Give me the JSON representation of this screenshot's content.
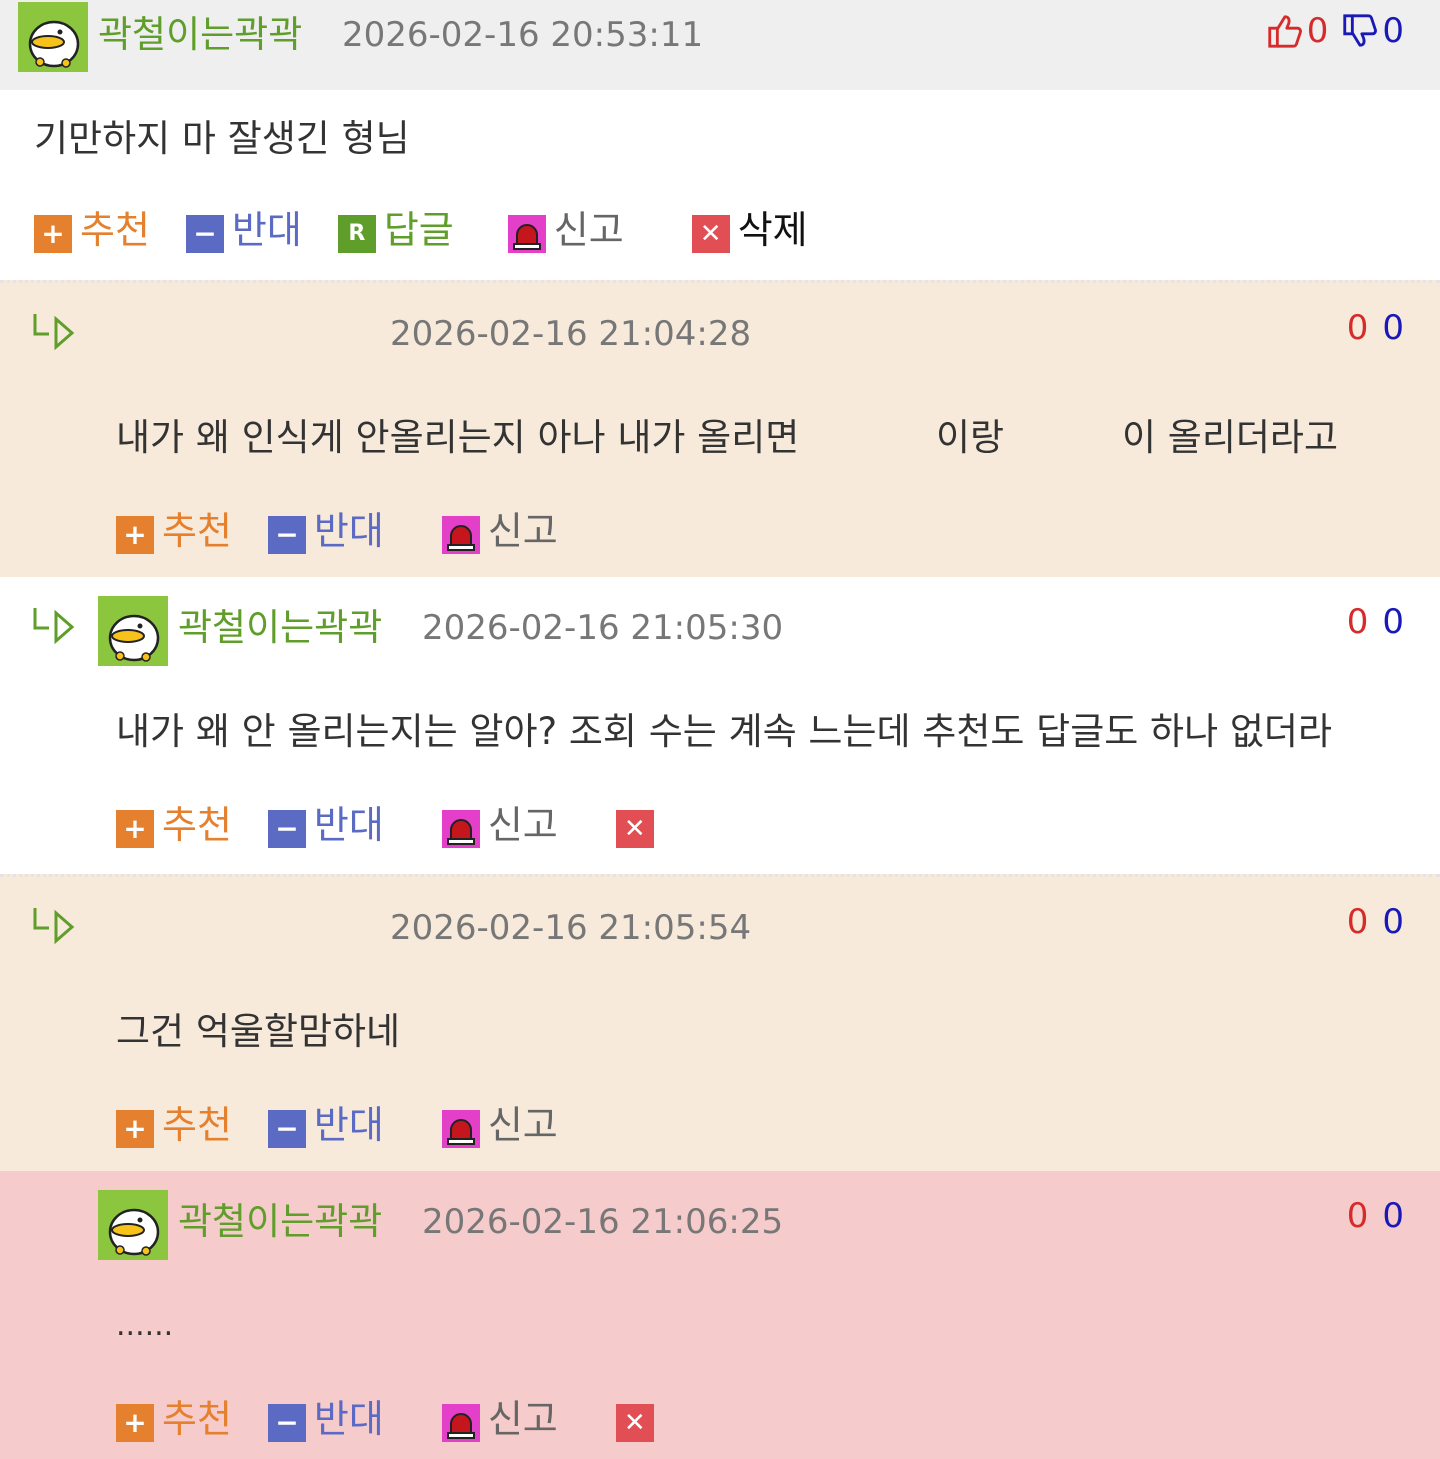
{
  "colors": {
    "header_bg": "#efefef",
    "reply_bg": "#f7eadb",
    "highlight_bg": "#f6cbcb",
    "nick_green": "#5f9e2a",
    "up_red": "#d62b2b",
    "down_blue": "#1919b8"
  },
  "actions": {
    "recommend": "추천",
    "oppose": "반대",
    "reply": "답글",
    "report": "신고",
    "delete": "삭제"
  },
  "comments": [
    {
      "nickname": "곽철이는곽곽",
      "time": "2026-02-16 20:53:11",
      "up": "0",
      "down": "0",
      "text": "기만하지 마 잘생긴 형님"
    },
    {
      "nickname": "",
      "time": "2026-02-16 21:04:28",
      "up": "0",
      "down": "0",
      "text_parts": [
        "내가 왜 인식게 안올리는지 아나 내가 올리면",
        "이랑",
        "이 올리더라고"
      ]
    },
    {
      "nickname": "곽철이는곽곽",
      "time": "2026-02-16 21:05:30",
      "up": "0",
      "down": "0",
      "text": "내가 왜 안 올리는지는 알아? 조회 수는 계속 느는데 추천도 답글도 하나 없더라"
    },
    {
      "nickname": "",
      "time": "2026-02-16 21:05:54",
      "up": "0",
      "down": "0",
      "text": "그건 억울할맘하네"
    },
    {
      "nickname": "곽철이는곽곽",
      "time": "2026-02-16 21:06:25",
      "up": "0",
      "down": "0",
      "text": "......"
    }
  ]
}
